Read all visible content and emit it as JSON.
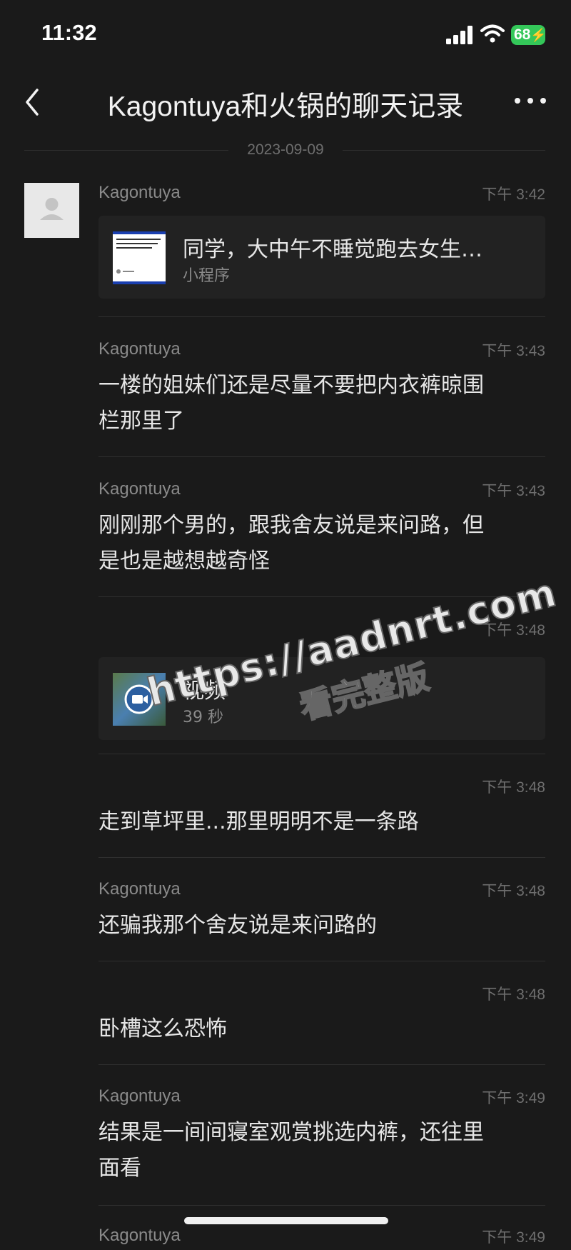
{
  "status": {
    "time": "11:32",
    "battery": "68"
  },
  "header": {
    "title": "Kagontuya和火锅的聊天记录"
  },
  "date_separator": "2023-09-09",
  "messages": [
    {
      "sender": "Kagontuya",
      "time": "下午 3:42",
      "card": {
        "title": "同学，大中午不睡觉跑去女生…",
        "subtitle": "小程序",
        "type": "mini-program"
      }
    },
    {
      "sender": "Kagontuya",
      "time": "下午 3:43",
      "text": [
        "一楼的姐妹们还是尽量不要把内衣裤晾围",
        "栏那里了"
      ]
    },
    {
      "sender": "Kagontuya",
      "time": "下午 3:43",
      "text": [
        "刚刚那个男的，跟我舍友说是来问路，但",
        "是也是越想越奇怪"
      ]
    },
    {
      "sender": "",
      "time": "下午 3:48",
      "card": {
        "title": "视频",
        "subtitle": "39 秒",
        "type": "video"
      }
    },
    {
      "sender": "",
      "time": "下午 3:48",
      "text": [
        "走到草坪里...那里明明不是一条路"
      ]
    },
    {
      "sender": "Kagontuya",
      "time": "下午 3:48",
      "text": [
        "还骗我那个舍友说是来问路的"
      ]
    },
    {
      "sender": "",
      "time": "下午 3:48",
      "text": [
        "卧槽这么恐怖"
      ]
    },
    {
      "sender": "Kagontuya",
      "time": "下午 3:49",
      "text": [
        "结果是一间间寝室观赏挑选内裤，还往里",
        "面看"
      ]
    },
    {
      "sender": "Kagontuya",
      "time": "下午 3:49"
    }
  ],
  "watermark": {
    "line1": "https://aadnrt.com",
    "line2": "看完整版"
  }
}
